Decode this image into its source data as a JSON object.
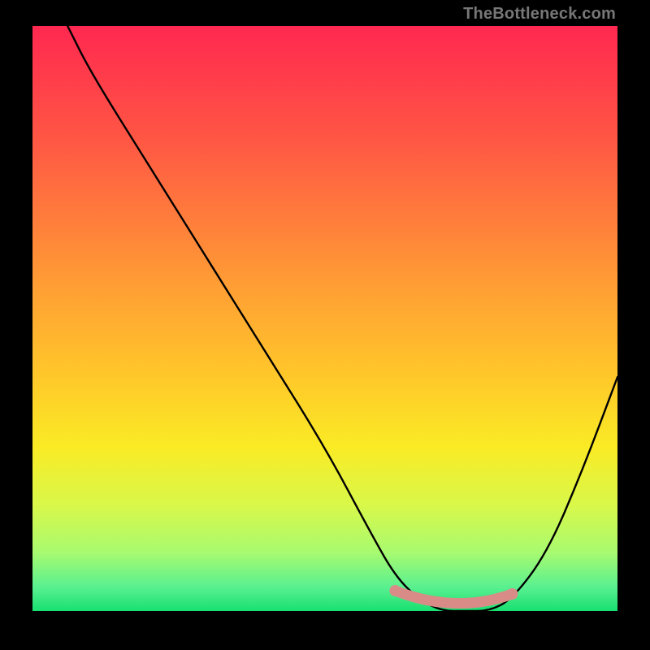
{
  "watermark": "TheBottleneck.com",
  "chart_data": {
    "type": "line",
    "title": "",
    "xlabel": "",
    "ylabel": "",
    "xlim": [
      0,
      100
    ],
    "ylim": [
      0,
      100
    ],
    "grid": false,
    "legend": false,
    "background_gradient": {
      "from": "#ff2850",
      "through": [
        "#ff7a3c",
        "#ffc82a",
        "#d8f84a"
      ],
      "to": "#18e070"
    },
    "series": [
      {
        "name": "bottleneck-curve",
        "color": "#000000",
        "x": [
          6,
          10,
          20,
          30,
          40,
          50,
          58,
          62,
          66,
          70,
          74,
          78,
          82,
          88,
          94,
          100
        ],
        "y": [
          100,
          92,
          76,
          60,
          44,
          28,
          13,
          6,
          2,
          0,
          0,
          0,
          2,
          10,
          24,
          40
        ]
      }
    ],
    "highlight": {
      "name": "optimal-range",
      "color": "#d98b87",
      "x_start": 62,
      "x_end": 82,
      "y": 0
    }
  }
}
